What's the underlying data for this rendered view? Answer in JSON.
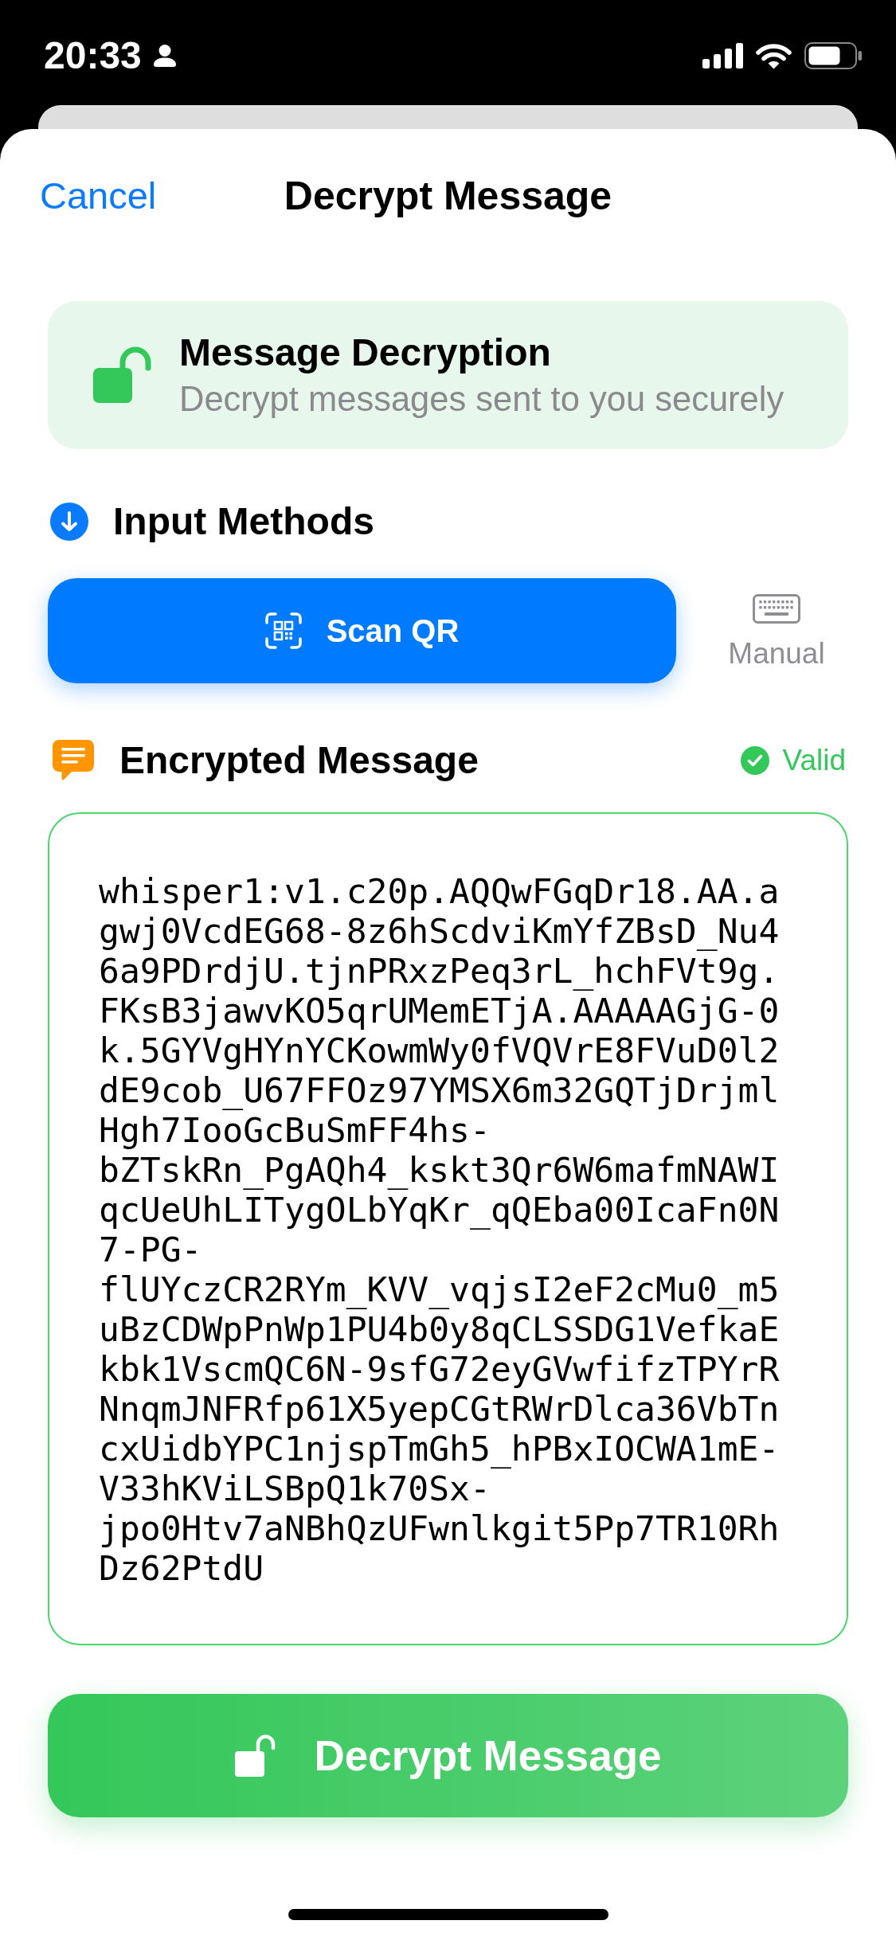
{
  "status_bar": {
    "time": "20:33"
  },
  "nav": {
    "cancel": "Cancel",
    "title": "Decrypt Message"
  },
  "info_card": {
    "title": "Message Decryption",
    "subtitle": "Decrypt messages sent to you securely"
  },
  "input_methods": {
    "title": "Input Methods",
    "options": [
      {
        "kind": "qr",
        "label": "Scan QR",
        "selected": true
      },
      {
        "kind": "keyboard",
        "label": "Manual",
        "selected": false
      }
    ]
  },
  "encrypted_message": {
    "title": "Encrypted Message",
    "status": "Valid",
    "valid": true,
    "value": "whisper1:v1.c20p.AQQwFGqDr18.AA.agwj0VcdEG68-8z6hScdviKmYfZBsD_Nu46a9PDrdjU.tjnPRxzPeq3rL_hchFVt9g.FKsB3jawvKO5qrUMemETjA.AAAAAGjG-0k.5GYVgHYnYCKowmWy0fVQVrE8FVuD0l2dE9cob_U67FFOz97YMSX6m32GQTjDrjmlHgh7IooGcBuSmFF4hs-bZTskRn_PgAQh4_kskt3Qr6W6mafmNAWIqcUeUhLITygOLbYqKr_qQEba00IcaFn0N7-PG-flUYczCR2RYm_KVV_vqjsI2eF2cMu0_m5uBzCDWpPnWp1PU4b0y8qCLSSDG1VefkaEkbk1VscmQC6N-9sfG72eyGVwfifzTPYrRNnqmJNFRfp61X5yepCGtRWrDlca36VbTncxUidbYPC1njspTmGh5_hPBxIOCWA1mE-V33hKViLSBpQ1k70Sx-jpo0Htv7aNBhQzUFwnlkgit5Pp7TR10RhDz62PtdU"
  },
  "action_button": {
    "label": "Decrypt Message"
  }
}
